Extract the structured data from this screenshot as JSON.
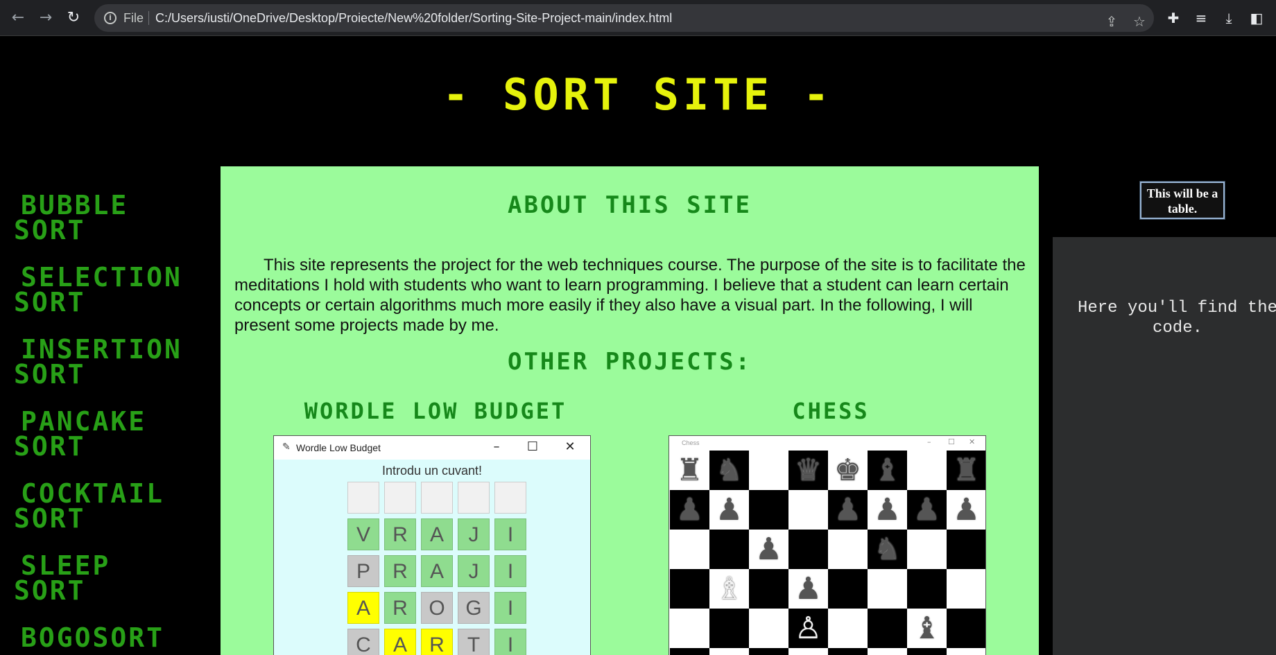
{
  "browser": {
    "scheme": "File",
    "url": "C:/Users/iusti/OneDrive/Desktop/Proiecte/New%20folder/Sorting-Site-Project-main/index.html"
  },
  "site": {
    "title": "- SORT SITE -"
  },
  "sidebar": {
    "items": [
      {
        "line1": "BUBBLE",
        "line2": "SORT"
      },
      {
        "line1": "SELECTION",
        "line2": "SORT"
      },
      {
        "line1": "INSERTION",
        "line2": "SORT"
      },
      {
        "line1": "PANCAKE",
        "line2": "SORT"
      },
      {
        "line1": "COCKTAIL",
        "line2": "SORT"
      },
      {
        "line1": "SLEEP",
        "line2": "SORT"
      },
      {
        "line1": "BOGOSORT",
        "line2": ""
      }
    ]
  },
  "main": {
    "about_title": "ABOUT THIS SITE",
    "about_text": "This site represents the project for the web techniques course. The purpose of the site is to facilitate the meditations I hold with students who want to learn programming. I believe that a student can learn certain concepts or certain algorithms much more easily if they also have a visual part. In the following, I will present some projects made by me.",
    "other_title": "OTHER PROJECTS:",
    "projects": [
      {
        "title": "WORDLE LOW BUDGET"
      },
      {
        "title": "CHESS"
      }
    ]
  },
  "wordle": {
    "window_title": "Wordle Low Budget",
    "prompt": "Introdu un cuvant!",
    "rows": [
      [
        {
          "l": "",
          "c": "empty"
        },
        {
          "l": "",
          "c": "empty"
        },
        {
          "l": "",
          "c": "empty"
        },
        {
          "l": "",
          "c": "empty"
        },
        {
          "l": "",
          "c": "empty"
        }
      ],
      [
        {
          "l": "V",
          "c": "green"
        },
        {
          "l": "R",
          "c": "green"
        },
        {
          "l": "A",
          "c": "green"
        },
        {
          "l": "J",
          "c": "green"
        },
        {
          "l": "I",
          "c": "green"
        }
      ],
      [
        {
          "l": "P",
          "c": "gray"
        },
        {
          "l": "R",
          "c": "green"
        },
        {
          "l": "A",
          "c": "green"
        },
        {
          "l": "J",
          "c": "green"
        },
        {
          "l": "I",
          "c": "green"
        }
      ],
      [
        {
          "l": "A",
          "c": "yellow"
        },
        {
          "l": "R",
          "c": "green"
        },
        {
          "l": "O",
          "c": "gray"
        },
        {
          "l": "G",
          "c": "gray"
        },
        {
          "l": "I",
          "c": "green"
        }
      ],
      [
        {
          "l": "C",
          "c": "gray"
        },
        {
          "l": "A",
          "c": "yellow"
        },
        {
          "l": "R",
          "c": "yellow"
        },
        {
          "l": "T",
          "c": "gray"
        },
        {
          "l": "I",
          "c": "green"
        }
      ]
    ]
  },
  "chess": {
    "window_title": "Chess",
    "pieces": [
      {
        "r": 0,
        "f": 0,
        "p": "♜",
        "side": "b"
      },
      {
        "r": 0,
        "f": 1,
        "p": "♞",
        "side": "b"
      },
      {
        "r": 0,
        "f": 3,
        "p": "♛",
        "side": "b"
      },
      {
        "r": 0,
        "f": 4,
        "p": "♚",
        "side": "b"
      },
      {
        "r": 0,
        "f": 5,
        "p": "♝",
        "side": "b"
      },
      {
        "r": 0,
        "f": 7,
        "p": "♜",
        "side": "b"
      },
      {
        "r": 1,
        "f": 0,
        "p": "♟",
        "side": "b"
      },
      {
        "r": 1,
        "f": 1,
        "p": "♟",
        "side": "b"
      },
      {
        "r": 1,
        "f": 4,
        "p": "♟",
        "side": "b"
      },
      {
        "r": 1,
        "f": 5,
        "p": "♟",
        "side": "b"
      },
      {
        "r": 1,
        "f": 6,
        "p": "♟",
        "side": "b"
      },
      {
        "r": 1,
        "f": 7,
        "p": "♟",
        "side": "b"
      },
      {
        "r": 2,
        "f": 2,
        "p": "♟",
        "side": "b"
      },
      {
        "r": 2,
        "f": 5,
        "p": "♞",
        "side": "b"
      },
      {
        "r": 3,
        "f": 1,
        "p": "♗",
        "side": "w"
      },
      {
        "r": 3,
        "f": 3,
        "p": "♟",
        "side": "b"
      },
      {
        "r": 4,
        "f": 3,
        "p": "♙",
        "side": "w"
      },
      {
        "r": 4,
        "f": 6,
        "p": "♝",
        "side": "b"
      }
    ]
  },
  "right": {
    "table_note": "This will be a table.",
    "code_note": "Here you'll find the code."
  },
  "colors": {
    "title_yellow": "#e6f20c",
    "sidebar_green": "#28a017",
    "content_bg": "#9bfb9b",
    "heading_green": "#16881a"
  }
}
